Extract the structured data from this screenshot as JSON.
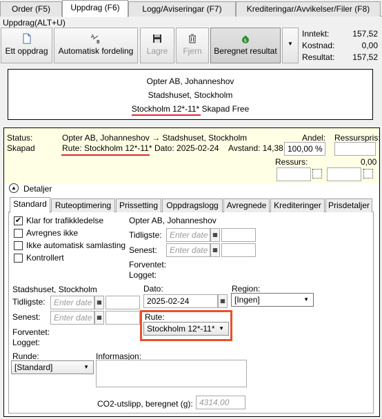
{
  "tabs": [
    {
      "label": "Order (F5)"
    },
    {
      "label": "Uppdrag (F6)"
    },
    {
      "label": "Logg/Aviseringar (F7)"
    },
    {
      "label": "Krediteringar/Avvikelser/Filer (F8)"
    }
  ],
  "menu_label": "Uppdrag(ALT+U)",
  "toolbar": {
    "ett_oppdrag": "Ett oppdrag",
    "automatisk_fordeling": "Automatisk fordeling",
    "lagre": "Lagre",
    "fjern": "Fjern",
    "beregnet_resultat": "Beregnet resultat"
  },
  "summary": {
    "inntekt_label": "Inntekt:",
    "inntekt_value": "157,52",
    "kostnad_label": "Kostnad:",
    "kostnad_value": "0,00",
    "resultat_label": "Resultat:",
    "resultat_value": "157,52"
  },
  "address": {
    "line1": "Opter AB, Johanneshov",
    "line2": "Stadshuset, Stockholm",
    "line3_route": "Stockholm 12*-11*",
    "line3_rest": "Skapad Free"
  },
  "status": {
    "status_label": "Status:",
    "status_value": "Skapad",
    "route_desc": "Opter AB, Johanneshov → Stadshuset, Stockholm",
    "rute_text": "Rute: Stockholm 12*-11*",
    "dato_text": "Dato: 2025-02-24",
    "avstand_text": "Avstand: 14,38",
    "andel_label": "Andel:",
    "andel_value": "100,00 %",
    "ressurspris_label": "Ressurspris:",
    "ressurs_label": "Ressurs:",
    "ressurs_value": "0,00"
  },
  "details_label": "Detaljer",
  "inner_tabs": [
    {
      "label": "Standard"
    },
    {
      "label": "Ruteoptimering"
    },
    {
      "label": "Prissetting"
    },
    {
      "label": "Oppdragslogg"
    },
    {
      "label": "Avregnede"
    },
    {
      "label": "Krediteringer"
    },
    {
      "label": "Prisdetaljer"
    }
  ],
  "checkboxes": [
    {
      "label": "Klar for trafikkledelse",
      "checked": true,
      "mark": "✔"
    },
    {
      "label": "Avregnes ikke",
      "checked": false,
      "mark": ""
    },
    {
      "label": "Ikke automatisk samlasting",
      "checked": false,
      "mark": ""
    },
    {
      "label": "Kontrollert",
      "checked": false,
      "mark": ""
    }
  ],
  "pickup": {
    "name": "Opter AB, Johanneshov",
    "tidligste_label": "Tidligste:",
    "senest_label": "Senest:",
    "placeholder": "Enter date",
    "forventet_label": "Forventet:",
    "logget_label": "Logget:"
  },
  "delivery": {
    "name": "Stadshuset, Stockholm",
    "tidligste_label": "Tidligste:",
    "senest_label": "Senest:",
    "placeholder": "Enter date",
    "forventet_label": "Forventet:",
    "logget_label": "Logget:"
  },
  "dato": {
    "label": "Dato:",
    "value": "2025-02-24"
  },
  "region": {
    "label": "Region:",
    "value": "[Ingen]"
  },
  "rute": {
    "label": "Rute:",
    "value": "Stockholm 12*-11*"
  },
  "runde": {
    "label": "Runde:",
    "value": "[Standard]"
  },
  "informasjon_label": "Informasjon:",
  "co2": {
    "label": "CO2-utslipp, beregnet (g):",
    "value": "4314,00"
  },
  "colors": {
    "highlight_red": "#e0262d",
    "highlight_orange": "#e8502a",
    "status_bg": "#ffffe6"
  }
}
